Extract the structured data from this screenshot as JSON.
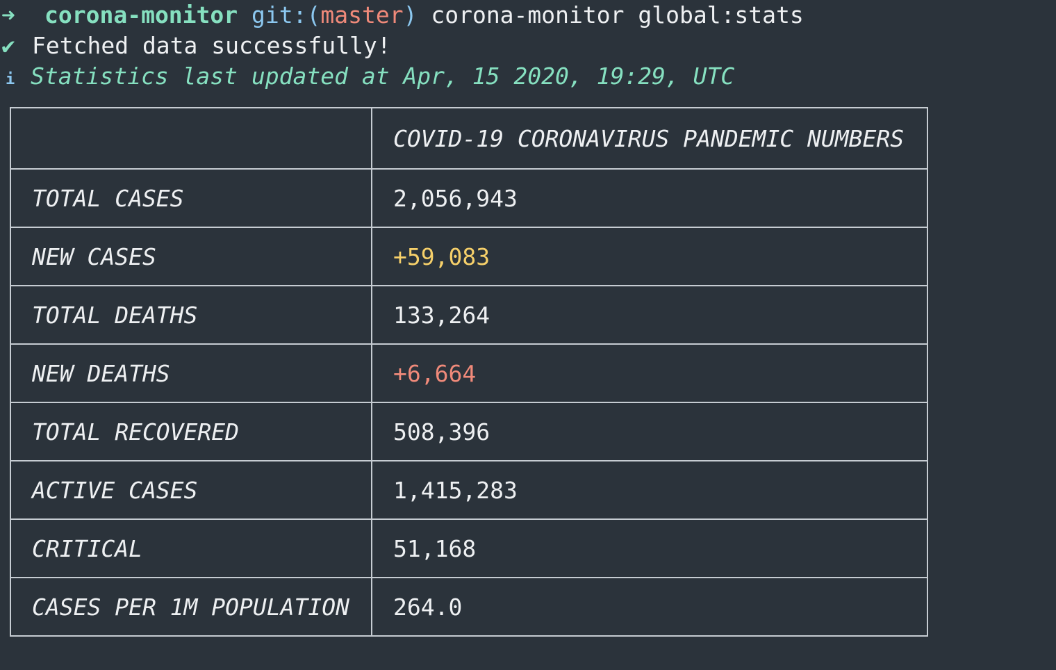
{
  "prompt": {
    "arrow": "➜",
    "directory": "corona-monitor",
    "git_prefix": "git:(",
    "branch": "master",
    "git_suffix": ")",
    "command": "corona-monitor global:stats"
  },
  "messages": {
    "success_icon": "✔",
    "success_text": "Fetched data successfully!",
    "info_icon": "i",
    "info_text": "Statistics last updated at Apr, 15 2020, 19:29, UTC"
  },
  "table": {
    "header": "COVID-19 CORONAVIRUS PANDEMIC NUMBERS",
    "rows": [
      {
        "label": "TOTAL CASES",
        "value": "2,056,943",
        "color": "#eef0f2"
      },
      {
        "label": "NEW CASES",
        "value": "+59,083",
        "color": "#f6d06a"
      },
      {
        "label": "TOTAL DEATHS",
        "value": "133,264",
        "color": "#eef0f2"
      },
      {
        "label": "NEW DEATHS",
        "value": "+6,664",
        "color": "#f08a7a"
      },
      {
        "label": "TOTAL RECOVERED",
        "value": "508,396",
        "color": "#eef0f2"
      },
      {
        "label": "ACTIVE CASES",
        "value": "1,415,283",
        "color": "#eef0f2"
      },
      {
        "label": "CRITICAL",
        "value": "51,168",
        "color": "#eef0f2"
      },
      {
        "label": "CASES PER 1M POPULATION",
        "value": "264.0",
        "color": "#eef0f2"
      }
    ]
  },
  "colors": {
    "background": "#2b333b",
    "foreground": "#eef0f2",
    "green": "#86e0c0",
    "blue": "#8cc8f0",
    "red": "#f08a7a",
    "yellow": "#f6d06a",
    "border": "#c6ccd2"
  }
}
